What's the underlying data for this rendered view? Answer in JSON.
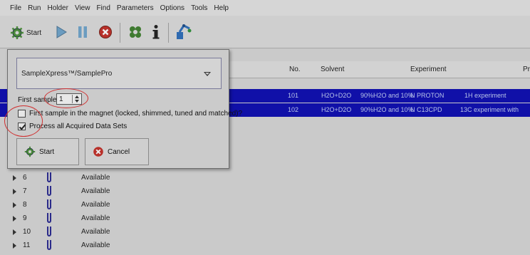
{
  "menu": [
    "File",
    "Run",
    "Holder",
    "View",
    "Find",
    "Parameters",
    "Options",
    "Tools",
    "Help"
  ],
  "toolbar": {
    "start_label": "Start",
    "icons": [
      "start-gear-icon",
      "play-icon",
      "pause-icon",
      "stop-icon",
      "settings-icon",
      "info-icon",
      "robot-icon"
    ]
  },
  "table": {
    "headers": {
      "no": "No.",
      "solvent": "Solvent",
      "experiment": "Experiment",
      "pr": "Pr"
    },
    "rows": [
      {
        "no": "101",
        "solvent": "H2O+D2O",
        "desc": "90%H2O and 10%",
        "exp": "N PROTON",
        "title": "1H experiment"
      },
      {
        "no": "102",
        "solvent": "H2O+D2O",
        "desc": "90%H2O and 10%",
        "exp": "N C13CPD",
        "title": "13C experiment with"
      }
    ]
  },
  "holders": [
    {
      "num": "6",
      "status": "Available"
    },
    {
      "num": "7",
      "status": "Available"
    },
    {
      "num": "8",
      "status": "Available"
    },
    {
      "num": "9",
      "status": "Available"
    },
    {
      "num": "10",
      "status": "Available"
    },
    {
      "num": "11",
      "status": "Available"
    }
  ],
  "dialog": {
    "combo_value": "SampleXpress™/SamplePro",
    "first_sample_label": "First sample",
    "first_sample_value": "1",
    "cb_magnet_label": "First sample in the magnet (locked, shimmed, tuned and matched)?",
    "cb_magnet_checked": false,
    "cb_process_label": "Process all Acquired Data Sets",
    "cb_process_checked": true,
    "start_label": "Start",
    "cancel_label": "Cancel"
  },
  "colors": {
    "selection": "#1010a8",
    "annotation": "#d03030"
  }
}
